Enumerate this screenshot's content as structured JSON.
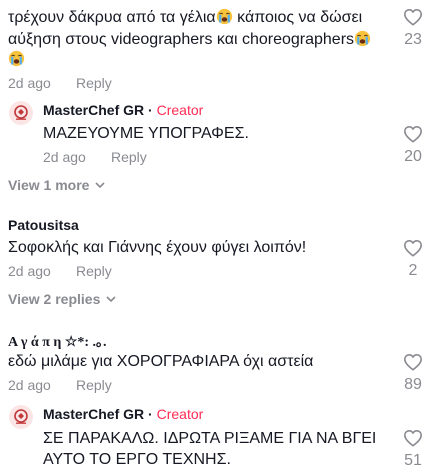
{
  "comments": [
    {
      "text_line1": "τρέχουν δάκρυα από τα γέλια",
      "text_line1b": " κάποιος να δώσει",
      "text_line2": "αύξηση στους videographers και choreographers",
      "date": "2d ago",
      "reply_label": "Reply",
      "likes": "23"
    },
    {
      "username": "MasterChef GR",
      "creator_label": "Creator",
      "text": "ΜΑΖΕΥΟΥΜΕ ΥΠΟΓΡΑΦΕΣ.",
      "date": "2d ago",
      "reply_label": "Reply",
      "likes": "20"
    },
    {
      "view_more": "View 1 more"
    },
    {
      "username": "Patousitsa",
      "text": "Σοφοκλής και Γιάννης έχουν φύγει λοιπόν!",
      "date": "2d ago",
      "reply_label": "Reply",
      "likes": "2"
    },
    {
      "view_more": "View 2 replies"
    },
    {
      "username": "Α γ ά π η ☆*: .｡.",
      "text": "εδώ μιλάμε για ΧΟΡΟΓΡΑΦΙΑΡΑ όχι αστεία",
      "date": "2d ago",
      "reply_label": "Reply",
      "likes": "89"
    },
    {
      "username": "MasterChef GR",
      "creator_label": "Creator",
      "text_line1": "ΣΕ ΠΑΡΑΚΑΛΩ. ΙΔΡΩΤΑ ΡΙΞΑΜΕ ΓΙΑ ΝΑ ΒΓΕΙ",
      "text_line2": "ΑΥΤΟ ΤΟ ΕΡΓΟ ΤΕΧΝΗΣ.",
      "likes": "51"
    }
  ],
  "colors": {
    "creator": "#fe2c55",
    "muted": "#8a8b91",
    "text": "#161823"
  },
  "icons": {
    "like": "heart-outline-icon",
    "emoji": "loudly-crying-face-emoji",
    "avatar": "masterchef-logo-avatar"
  }
}
